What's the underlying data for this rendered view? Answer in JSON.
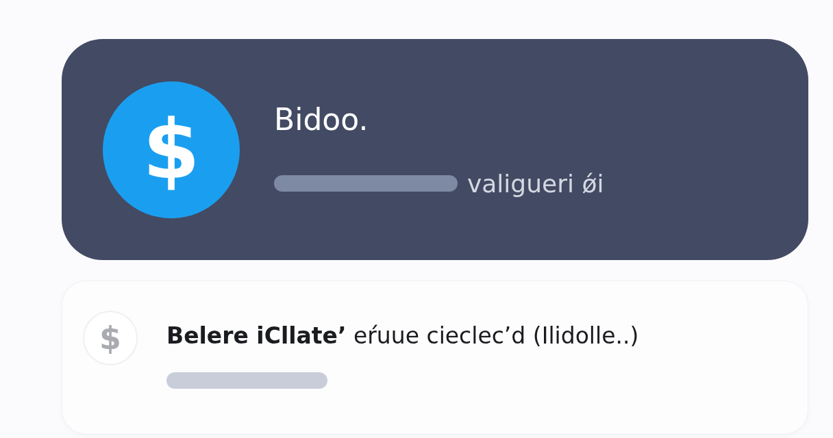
{
  "cards": [
    {
      "kind": "featured",
      "icon": "$",
      "title": "Bidoo.",
      "subtitle": "valigueri ǿi"
    },
    {
      "kind": "plain",
      "icon": "$",
      "title": "**Belere iCllate’** eŕuue cieclec’d (Ilidolle..)"
    }
  ]
}
